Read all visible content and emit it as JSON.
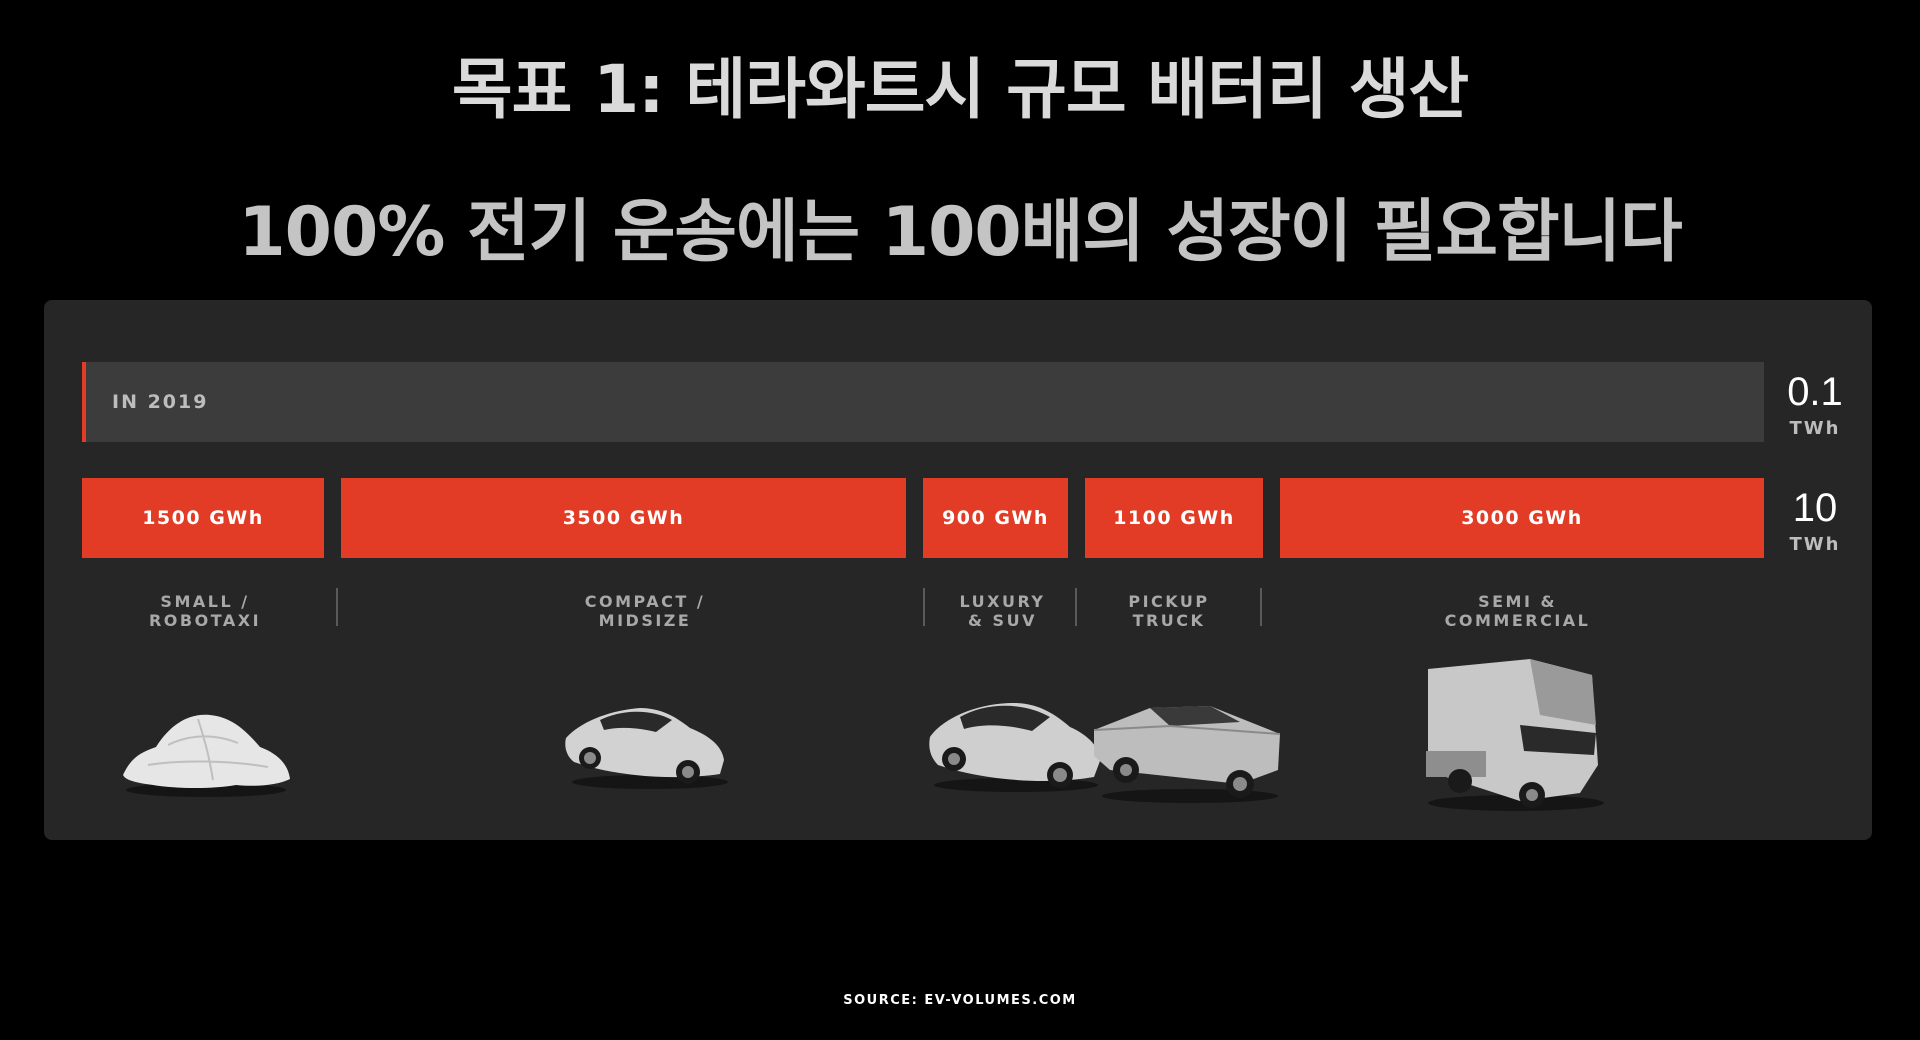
{
  "title": "목표 1: 테라와트시 규모 배터리 생산",
  "subtitle": "100% 전기 운송에는 100배의 성장이 필요합니다",
  "colors": {
    "accent": "#e33c26",
    "panel": "#262626",
    "bar_2019": "#3c3c3c",
    "background": "#000000"
  },
  "chart_data": {
    "type": "bar",
    "baseline": {
      "label": "IN 2019",
      "total_value": "0.1",
      "total_unit": "TWh"
    },
    "target": {
      "total_value": "10",
      "total_unit": "TWh",
      "categories": [
        "SMALL / ROBOTAXI",
        "COMPACT / MIDSIZE",
        "LUXURY & SUV",
        "PICKUP TRUCK",
        "SEMI & COMMERCIAL"
      ],
      "values": [
        1500,
        3500,
        900,
        1100,
        3000
      ],
      "unit": "GWh",
      "segment_labels": [
        "1500 GWh",
        "3500 GWh",
        "900 GWh",
        "1100 GWh",
        "3000 GWh"
      ]
    }
  },
  "categories": [
    {
      "line1": "SMALL /",
      "line2": "ROBOTAXI",
      "icon": "covered-car-icon"
    },
    {
      "line1": "COMPACT /",
      "line2": "MIDSIZE",
      "icon": "sedan-icon"
    },
    {
      "line1": "LUXURY",
      "line2": "& SUV",
      "icon": "suv-icon"
    },
    {
      "line1": "PICKUP",
      "line2": "TRUCK",
      "icon": "pickup-truck-icon"
    },
    {
      "line1": "SEMI &",
      "line2": "COMMERCIAL",
      "icon": "semi-truck-icon"
    }
  ],
  "source": "SOURCE: EV-VOLUMES.COM"
}
